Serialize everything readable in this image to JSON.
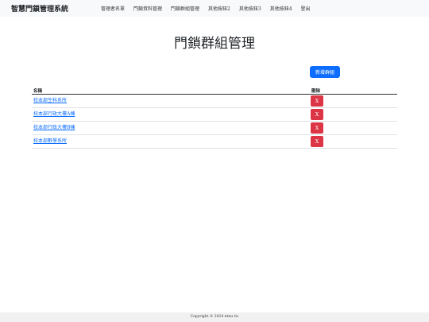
{
  "navbar": {
    "brand": "智慧門鎖管理系統",
    "items": [
      {
        "label": "管理者名單"
      },
      {
        "label": "門鎖資料管理"
      },
      {
        "label": "門鎖群組管理"
      },
      {
        "label": "其他按鈕2"
      },
      {
        "label": "其他按鈕3"
      },
      {
        "label": "其他按鈕4"
      },
      {
        "label": "登出"
      }
    ]
  },
  "main": {
    "title": "門鎖群組管理",
    "add_button_label": "新增群組",
    "table": {
      "headers": {
        "name": "名稱",
        "delete": "刪除"
      },
      "delete_button_label": "X",
      "rows": [
        {
          "name": "校本部生科系所"
        },
        {
          "name": "校本部行政大樓A棟"
        },
        {
          "name": "校本部行政大樓B棟"
        },
        {
          "name": "校本部數學系所"
        }
      ]
    }
  },
  "footer": {
    "copyright": "Copyright © 2024 ntnu tic"
  },
  "colors": {
    "primary": "#0d6efd",
    "danger": "#dc3545",
    "navbar_bg": "#f8f9fa"
  }
}
